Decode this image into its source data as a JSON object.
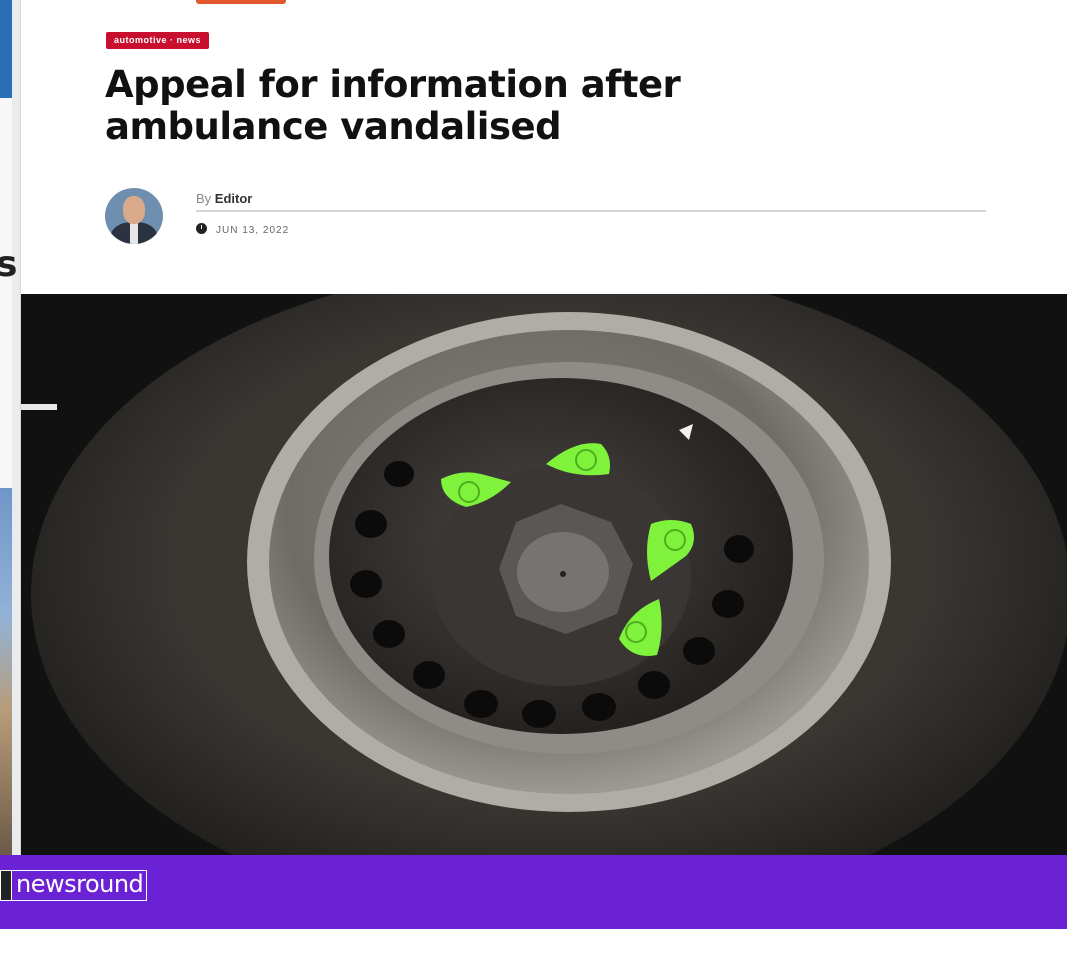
{
  "article": {
    "category": "automotive · news",
    "headline": "Appeal for information after ambulance vandalised",
    "byline_prefix": "By",
    "author": "Editor",
    "date": "JUN 13, 2022"
  },
  "brand": {
    "logo_text": "newsround"
  },
  "icons": {
    "date": "clock-icon",
    "logo": "newsround-logo-icon"
  },
  "colors": {
    "brand_bar": "#6b22d4",
    "category_badge": "#c8102e",
    "wheel_nut_indicators": "#7ff23c"
  }
}
